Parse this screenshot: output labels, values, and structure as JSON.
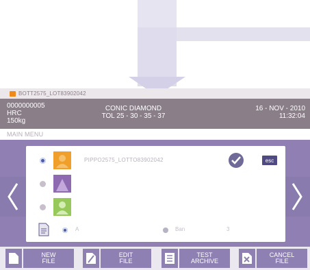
{
  "header": {
    "file_title": "BOTT2575_LOT83902042",
    "code": "0000000005",
    "scale": "HRC",
    "load": "150kg",
    "indenter": "CONIC DIAMOND",
    "tolerance": "TOL 25 - 30 - 35 - 37",
    "date": "16 - NOV - 2010",
    "time": "11:32:04"
  },
  "menu": {
    "title": "MAIN MENU"
  },
  "file_list": {
    "rows": [
      {
        "name": "PIPPO2575_LOTTO83902042",
        "thumb_color": "#f0a02a",
        "selected": true
      },
      {
        "name": "",
        "thumb_color": "#8e6ab0",
        "selected": false
      },
      {
        "name": "",
        "thumb_color": "#97c85a",
        "selected": false
      }
    ],
    "esc_label": "esc",
    "footer": {
      "field1": "A",
      "field2": "Ban",
      "field3": "3"
    }
  },
  "toolbar": {
    "new_file": "NEW\nFILE",
    "edit_file": "EDIT\nFILE",
    "test_archive": "TEST\nARCHIVE",
    "cancel_file": "CANCEL\nFILE"
  },
  "colors": {
    "accent": "#8f7fb3",
    "info_bar": "#8a7e89",
    "file_orange": "#ee8a1c"
  }
}
